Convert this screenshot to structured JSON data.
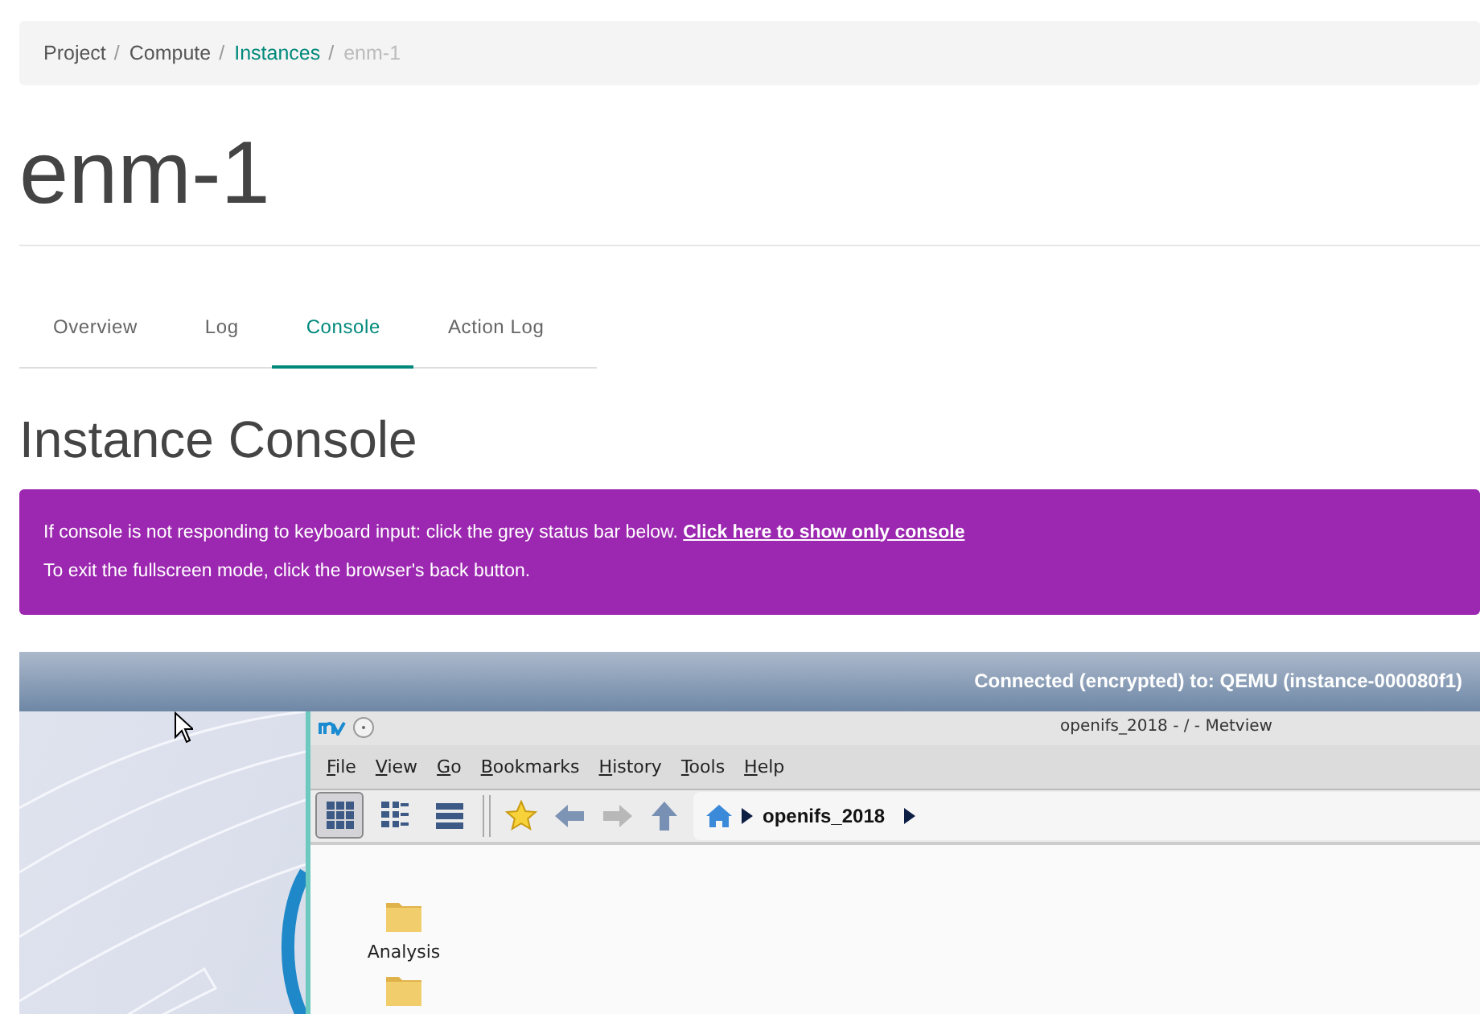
{
  "breadcrumb_separator": "/",
  "breadcrumb": [
    {
      "label": "Project",
      "kind": "text"
    },
    {
      "label": "Compute",
      "kind": "text"
    },
    {
      "label": "Instances",
      "kind": "link"
    },
    {
      "label": "enm-1",
      "kind": "current"
    }
  ],
  "title": "enm-1",
  "tabs": [
    {
      "label": "Overview",
      "selected": false
    },
    {
      "label": "Log",
      "selected": false
    },
    {
      "label": "Console",
      "selected": true
    },
    {
      "label": "Action Log",
      "selected": false
    }
  ],
  "section_title": "Instance Console",
  "alert": {
    "message": "If console is not responding to keyboard input: click the grey status bar below.",
    "link": "Click here to show only console",
    "note": "To exit the fullscreen mode, click the browser's back button."
  },
  "console": {
    "status": "Connected (encrypted) to: QEMU (instance-000080f1)",
    "window": {
      "title": "openifs_2018 - / - Metview",
      "menu": [
        "File",
        "View",
        "Go",
        "Bookmarks",
        "History",
        "Tools",
        "Help"
      ],
      "view_modes": [
        {
          "kind": "grid",
          "selected": true
        },
        {
          "kind": "detail",
          "selected": false
        },
        {
          "kind": "list",
          "selected": false
        }
      ],
      "path": "openifs_2018",
      "files": [
        {
          "kind": "folder",
          "label": "Analysis"
        },
        {
          "kind": "folder"
        }
      ]
    }
  }
}
